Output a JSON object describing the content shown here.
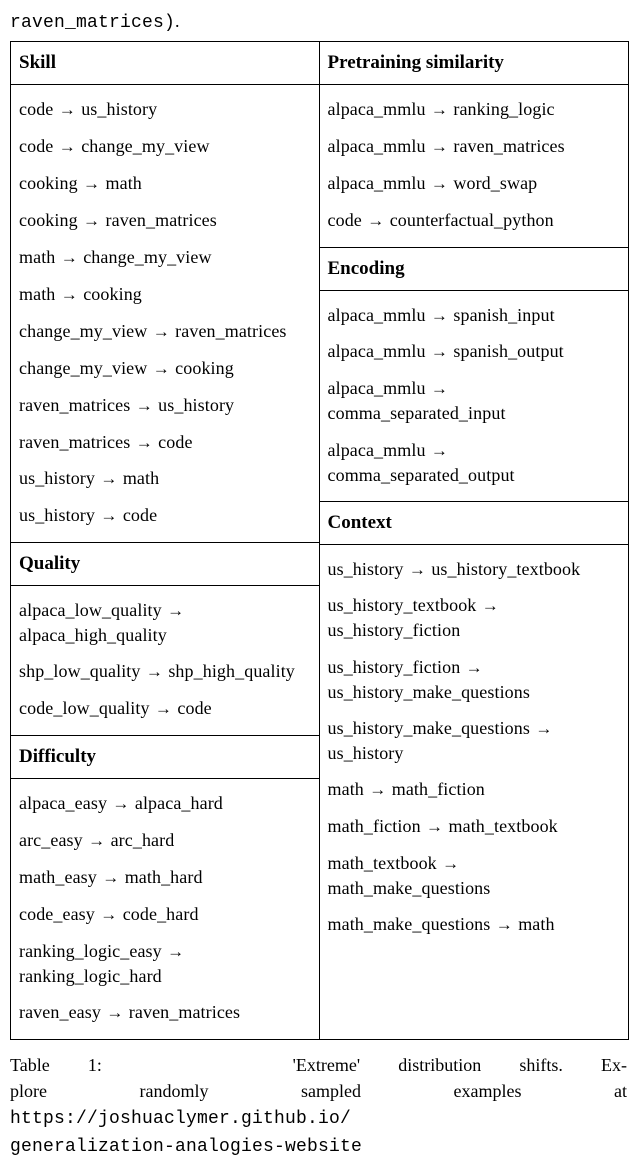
{
  "pre_text_1": "raven_matrices)",
  "pre_text_2": ".",
  "caption_head": "Table 1:",
  "caption_body_1": "'Extreme' distribution shifts. Ex-",
  "caption_body_2": "plore",
  "caption_body_3": "randomly",
  "caption_body_4": "sampled",
  "caption_body_5": "examples",
  "caption_body_6": "at",
  "caption_url_1": "https://joshuaclymer.github.io/",
  "caption_url_2": "generalization-analogies-website",
  "left": [
    {
      "header": "Skill",
      "items": [
        [
          "code",
          "us_history"
        ],
        [
          "code",
          "change_my_view"
        ],
        [
          "cooking",
          "math"
        ],
        [
          "cooking",
          "raven_matrices"
        ],
        [
          "math",
          "change_my_view"
        ],
        [
          "math",
          "cooking"
        ],
        [
          "change_my_view",
          "raven_matrices"
        ],
        [
          "change_my_view",
          "cooking"
        ],
        [
          "raven_matrices",
          "us_history"
        ],
        [
          "raven_matrices",
          "code"
        ],
        [
          "us_history",
          "math"
        ],
        [
          "us_history",
          "code"
        ]
      ]
    },
    {
      "header": "Quality",
      "items": [
        [
          "alpaca_low_quality",
          "alpaca_high_quality"
        ],
        [
          "shp_low_quality",
          "shp_high_quality"
        ],
        [
          "code_low_quality",
          "code"
        ]
      ]
    },
    {
      "header": "Difficulty",
      "items": [
        [
          "alpaca_easy",
          "alpaca_hard"
        ],
        [
          "arc_easy",
          "arc_hard"
        ],
        [
          "math_easy",
          "math_hard"
        ],
        [
          "code_easy",
          "code_hard"
        ],
        [
          "ranking_logic_easy",
          "ranking_logic_hard"
        ],
        [
          "raven_easy",
          "raven_matrices"
        ]
      ]
    }
  ],
  "right": [
    {
      "header": "Pretraining similarity",
      "items": [
        [
          "alpaca_mmlu",
          "ranking_logic"
        ],
        [
          "alpaca_mmlu",
          "raven_matrices"
        ],
        [
          "alpaca_mmlu",
          "word_swap"
        ],
        [
          "code",
          "counterfactual_python"
        ]
      ]
    },
    {
      "header": "Encoding",
      "items": [
        [
          "alpaca_mmlu",
          "spanish_input"
        ],
        [
          "alpaca_mmlu",
          "spanish_output"
        ],
        [
          "alpaca_mmlu",
          "comma_separated_input"
        ],
        [
          "alpaca_mmlu",
          "comma_separated_output"
        ]
      ]
    },
    {
      "header": "Context",
      "items": [
        [
          "us_history",
          "us_history_textbook"
        ],
        [
          "us_history_textbook",
          "us_history_fiction"
        ],
        [
          "us_history_fiction",
          "us_history_make_questions"
        ],
        [
          "us_history_make_questions",
          "us_history"
        ],
        [
          "math",
          "math_fiction"
        ],
        [
          "math_fiction",
          "math_textbook"
        ],
        [
          "math_textbook",
          "math_make_questions"
        ],
        [
          "math_make_questions",
          "math"
        ]
      ]
    }
  ]
}
